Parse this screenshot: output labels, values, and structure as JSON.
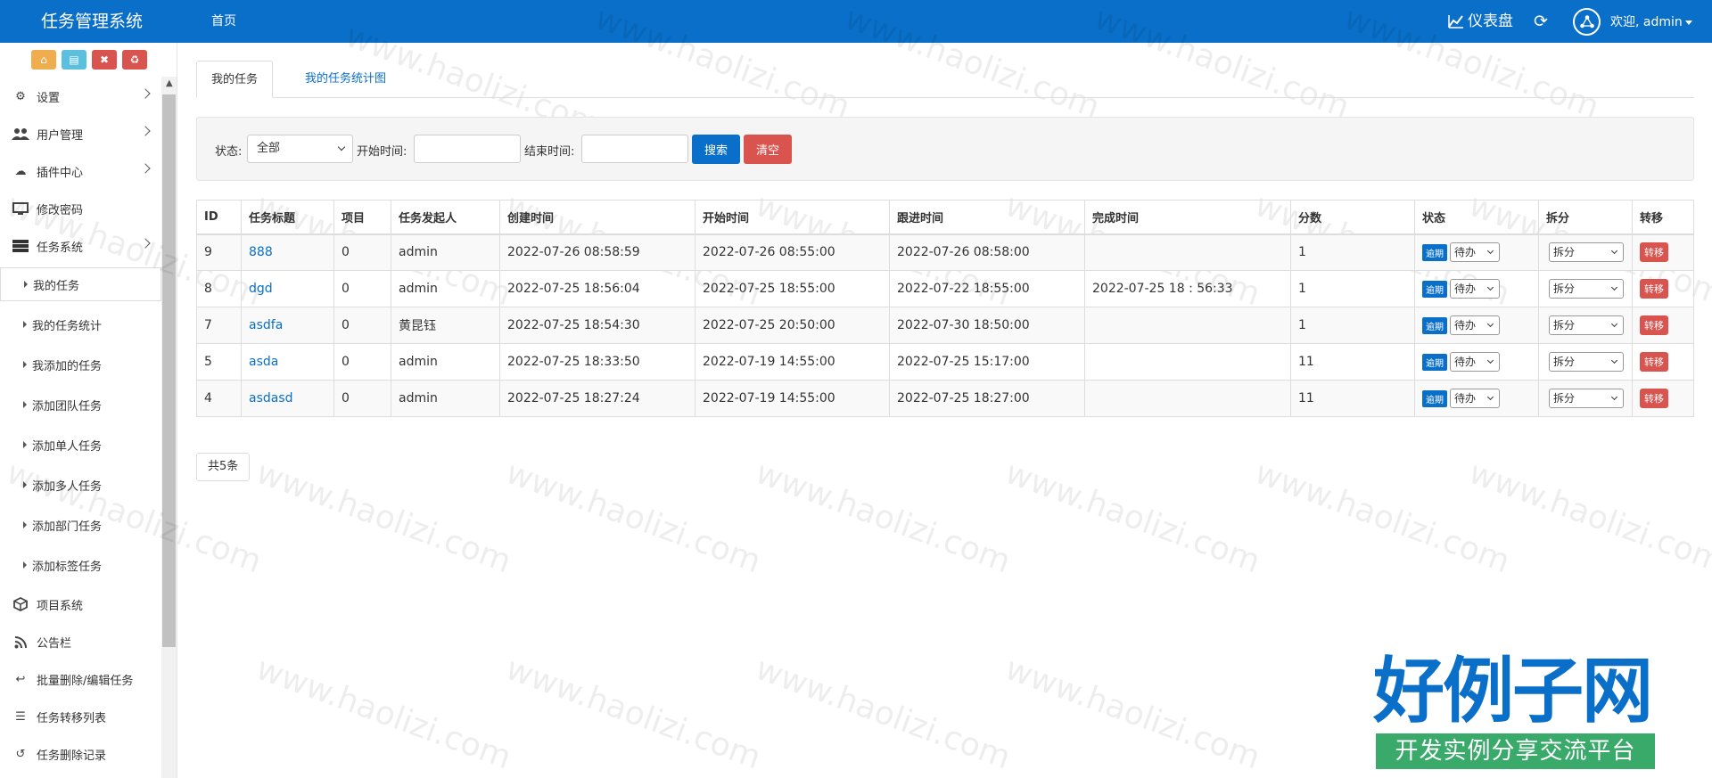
{
  "header": {
    "brand": "任务管理系统",
    "home": "首页",
    "dashboard": "仪表盘",
    "welcome": "欢迎, admin"
  },
  "sidebar": {
    "menu": [
      {
        "label": "设置",
        "icon": "gears-icon",
        "arrow": true
      },
      {
        "label": "用户管理",
        "icon": "users-icon",
        "arrow": true
      },
      {
        "label": "插件中心",
        "icon": "cloud-icon",
        "arrow": true
      },
      {
        "label": "修改密码",
        "icon": "desktop-icon",
        "arrow": false
      },
      {
        "label": "任务系统",
        "icon": "server-icon",
        "arrow": true
      }
    ],
    "sub": [
      {
        "label": "我的任务"
      },
      {
        "label": "我的任务统计"
      },
      {
        "label": "我添加的任务"
      },
      {
        "label": "添加团队任务"
      },
      {
        "label": "添加单人任务"
      },
      {
        "label": "添加多人任务"
      },
      {
        "label": "添加部门任务"
      },
      {
        "label": "添加标签任务"
      }
    ],
    "menu2": [
      {
        "label": "项目系统",
        "icon": "cube-icon"
      },
      {
        "label": "公告栏",
        "icon": "rss-icon"
      },
      {
        "label": "批量删除/编辑任务",
        "icon": "reply-icon"
      },
      {
        "label": "任务转移列表",
        "icon": "list-icon"
      },
      {
        "label": "任务删除记录",
        "icon": "undo-icon"
      }
    ]
  },
  "tabs": [
    "我的任务",
    "我的任务统计图"
  ],
  "search": {
    "status_label": "状态:",
    "status_value": "全部",
    "start_label": "开始时间:",
    "end_label": "结束时间:",
    "search_btn": "搜索",
    "clear_btn": "清空"
  },
  "table": {
    "headers": [
      "ID",
      "任务标题",
      "项目",
      "任务发起人",
      "创建时间",
      "开始时间",
      "跟进时间",
      "完成时间",
      "分数",
      "状态",
      "拆分",
      "转移"
    ],
    "rows": [
      {
        "id": "9",
        "title": "888",
        "project": "0",
        "initiator": "admin",
        "created": "2022-07-26 08:58:59",
        "start": "2022-07-26 08:55:00",
        "follow": "2022-07-26 08:58:00",
        "done": "",
        "score": "1"
      },
      {
        "id": "8",
        "title": "dgd",
        "project": "0",
        "initiator": "admin",
        "created": "2022-07-25 18:56:04",
        "start": "2022-07-25 18:55:00",
        "follow": "2022-07-22 18:55:00",
        "done": "2022-07-25 18 : 56:33",
        "score": "1"
      },
      {
        "id": "7",
        "title": "asdfa",
        "project": "0",
        "initiator": "黄昆钰",
        "created": "2022-07-25 18:54:30",
        "start": "2022-07-25 20:50:00",
        "follow": "2022-07-30 18:50:00",
        "done": "",
        "score": "1"
      },
      {
        "id": "5",
        "title": "asda",
        "project": "0",
        "initiator": "admin",
        "created": "2022-07-25 18:33:50",
        "start": "2022-07-19 14:55:00",
        "follow": "2022-07-25 15:17:00",
        "done": "",
        "score": "11"
      },
      {
        "id": "4",
        "title": "asdasd",
        "project": "0",
        "initiator": "admin",
        "created": "2022-07-25 18:27:24",
        "start": "2022-07-19 14:55:00",
        "follow": "2022-07-25 18:27:00",
        "done": "",
        "score": "11"
      }
    ],
    "overdue_tag": "逾期",
    "status_option": "待办",
    "split_option": "拆分",
    "transfer_btn": "转移"
  },
  "total": "共5条",
  "watermark": "www.haolizi.com",
  "logo": {
    "main": "好例子网",
    "sub": "开发实例分享交流平台"
  }
}
